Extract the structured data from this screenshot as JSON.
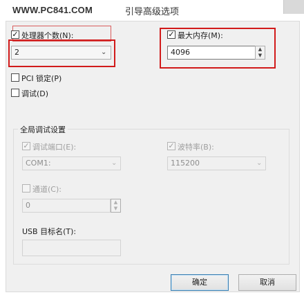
{
  "window": {
    "watermark": "WWW.PC841.COM",
    "title": "引导高级选项"
  },
  "processor_count": {
    "label": "处理器个数(N):",
    "checked": true,
    "value": "2"
  },
  "max_memory": {
    "label": "最大内存(M):",
    "checked": true,
    "value": "4096"
  },
  "pci_lock": {
    "label": "PCI 锁定(P)",
    "checked": false
  },
  "debug": {
    "label": "调试(D)",
    "checked": false
  },
  "global_debug": {
    "group_title": "全局调试设置",
    "debug_port": {
      "label": "调试端口(E):",
      "checked": true,
      "value": "COM1:"
    },
    "baud_rate": {
      "label": "波特率(B):",
      "checked": true,
      "value": "115200"
    },
    "channel": {
      "label": "通道(C):",
      "checked": false,
      "value": "0"
    },
    "usb_target": {
      "label": "USB 目标名(T):",
      "value": ""
    }
  },
  "buttons": {
    "ok": "确定",
    "cancel": "取消"
  },
  "icons": {
    "check": "check-icon",
    "chevron": "chevron-down-icon",
    "spin_up": "spin-up-icon",
    "spin_down": "spin-down-icon"
  },
  "colors": {
    "annotation_red": "#d11a1a",
    "default_button_border": "#3c7fb1",
    "disabled_text": "#9e9e9e"
  }
}
